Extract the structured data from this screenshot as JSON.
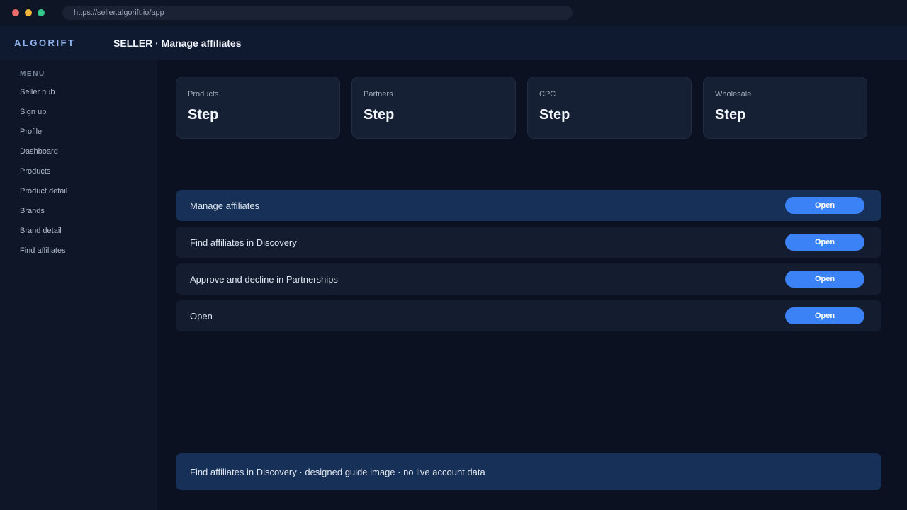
{
  "browser": {
    "url": "https://seller.algorift.io/app"
  },
  "header": {
    "logo": "ALGORIFT",
    "title": "SELLER · Manage affiliates"
  },
  "sidebar": {
    "heading": "MENU",
    "items": [
      {
        "label": "Seller hub"
      },
      {
        "label": "Sign up"
      },
      {
        "label": "Profile"
      },
      {
        "label": "Dashboard"
      },
      {
        "label": "Products"
      },
      {
        "label": "Product detail"
      },
      {
        "label": "Brands"
      },
      {
        "label": "Brand detail"
      },
      {
        "label": "Find affiliates"
      }
    ]
  },
  "cards": [
    {
      "label": "Products",
      "value": "Step"
    },
    {
      "label": "Partners",
      "value": "Step"
    },
    {
      "label": "CPC",
      "value": "Step"
    },
    {
      "label": "Wholesale",
      "value": "Step"
    }
  ],
  "tasks": [
    {
      "label": "Manage affiliates",
      "button": "Open"
    },
    {
      "label": "Find affiliates in Discovery",
      "button": "Open"
    },
    {
      "label": "Approve and decline in Partnerships",
      "button": "Open"
    },
    {
      "label": "Open",
      "button": "Open"
    }
  ],
  "footer": {
    "note": "Find affiliates in Discovery · designed guide image · no live account data"
  },
  "colors": {
    "accent": "#3b82f6",
    "background": "#0b1120",
    "active_row": "#173057"
  }
}
